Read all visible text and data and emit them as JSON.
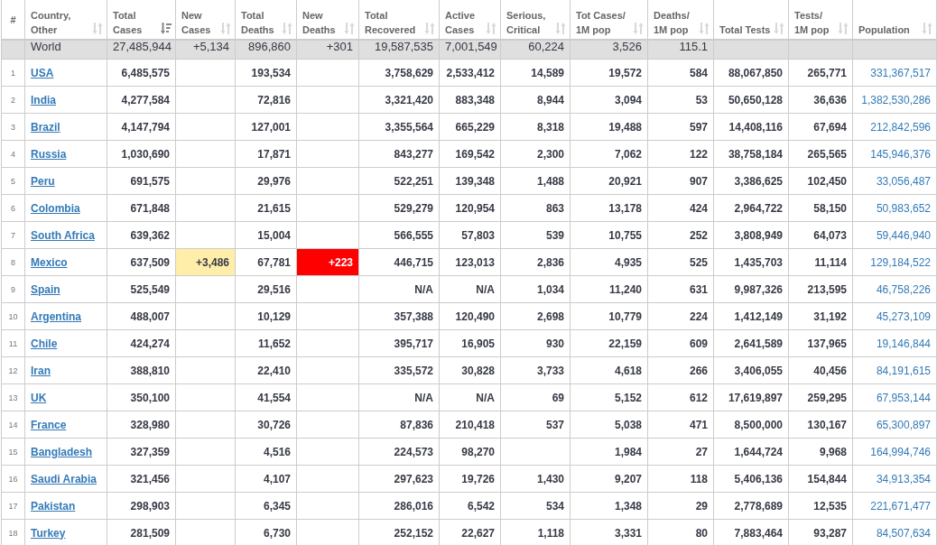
{
  "table": {
    "columns": [
      {
        "label": "#"
      },
      {
        "label": "Country, Other",
        "sorted": false
      },
      {
        "label": "Total Cases",
        "sorted": true
      },
      {
        "label": "New Cases",
        "sorted": false
      },
      {
        "label": "Total Deaths",
        "sorted": false
      },
      {
        "label": "New Deaths",
        "sorted": false
      },
      {
        "label": "Total Recovered",
        "sorted": false
      },
      {
        "label": "Active Cases",
        "sorted": false
      },
      {
        "label": "Serious, Critical",
        "sorted": false
      },
      {
        "label": "Tot Cases/ 1M pop",
        "sorted": false
      },
      {
        "label": "Deaths/ 1M pop",
        "sorted": false
      },
      {
        "label": "Total Tests",
        "sorted": false
      },
      {
        "label": "Tests/ 1M pop",
        "sorted": false
      },
      {
        "label": "Population",
        "sorted": false
      }
    ],
    "rows": [
      {
        "kind": "total",
        "country": "World",
        "total_cases": "27,485,944",
        "new_cases": "+5,134",
        "total_deaths": "896,860",
        "new_deaths": "+301",
        "total_recovered": "19,587,535",
        "active_cases": "7,001,549",
        "serious_critical": "60,224",
        "cases_per_1m": "3,526",
        "deaths_per_1m": "115.1"
      },
      {
        "kind": "country",
        "rank": "1",
        "country": "USA",
        "total_cases": "6,485,575",
        "total_deaths": "193,534",
        "total_recovered": "3,758,629",
        "active_cases": "2,533,412",
        "serious_critical": "14,589",
        "cases_per_1m": "19,572",
        "deaths_per_1m": "584",
        "total_tests": "88,067,850",
        "tests_per_1m": "265,771",
        "population": "331,367,517"
      },
      {
        "kind": "country",
        "rank": "2",
        "country": "India",
        "total_cases": "4,277,584",
        "total_deaths": "72,816",
        "total_recovered": "3,321,420",
        "active_cases": "883,348",
        "serious_critical": "8,944",
        "cases_per_1m": "3,094",
        "deaths_per_1m": "53",
        "total_tests": "50,650,128",
        "tests_per_1m": "36,636",
        "population": "1,382,530,286"
      },
      {
        "kind": "country",
        "rank": "3",
        "country": "Brazil",
        "total_cases": "4,147,794",
        "total_deaths": "127,001",
        "total_recovered": "3,355,564",
        "active_cases": "665,229",
        "serious_critical": "8,318",
        "cases_per_1m": "19,488",
        "deaths_per_1m": "597",
        "total_tests": "14,408,116",
        "tests_per_1m": "67,694",
        "population": "212,842,596"
      },
      {
        "kind": "country",
        "rank": "4",
        "country": "Russia",
        "total_cases": "1,030,690",
        "total_deaths": "17,871",
        "total_recovered": "843,277",
        "active_cases": "169,542",
        "serious_critical": "2,300",
        "cases_per_1m": "7,062",
        "deaths_per_1m": "122",
        "total_tests": "38,758,184",
        "tests_per_1m": "265,565",
        "population": "145,946,376"
      },
      {
        "kind": "country",
        "rank": "5",
        "country": "Peru",
        "total_cases": "691,575",
        "total_deaths": "29,976",
        "total_recovered": "522,251",
        "active_cases": "139,348",
        "serious_critical": "1,488",
        "cases_per_1m": "20,921",
        "deaths_per_1m": "907",
        "total_tests": "3,386,625",
        "tests_per_1m": "102,450",
        "population": "33,056,487"
      },
      {
        "kind": "country",
        "rank": "6",
        "country": "Colombia",
        "total_cases": "671,848",
        "total_deaths": "21,615",
        "total_recovered": "529,279",
        "active_cases": "120,954",
        "serious_critical": "863",
        "cases_per_1m": "13,178",
        "deaths_per_1m": "424",
        "total_tests": "2,964,722",
        "tests_per_1m": "58,150",
        "population": "50,983,652"
      },
      {
        "kind": "country",
        "rank": "7",
        "country": "South Africa",
        "total_cases": "639,362",
        "total_deaths": "15,004",
        "total_recovered": "566,555",
        "active_cases": "57,803",
        "serious_critical": "539",
        "cases_per_1m": "10,755",
        "deaths_per_1m": "252",
        "total_tests": "3,808,949",
        "tests_per_1m": "64,073",
        "population": "59,446,940"
      },
      {
        "kind": "country",
        "rank": "8",
        "country": "Mexico",
        "total_cases": "637,509",
        "new_cases": "+3,486",
        "total_deaths": "67,781",
        "new_deaths": "+223",
        "total_recovered": "446,715",
        "active_cases": "123,013",
        "serious_critical": "2,836",
        "cases_per_1m": "4,935",
        "deaths_per_1m": "525",
        "total_tests": "1,435,703",
        "tests_per_1m": "11,114",
        "population": "129,184,522"
      },
      {
        "kind": "country",
        "rank": "9",
        "country": "Spain",
        "total_cases": "525,549",
        "total_deaths": "29,516",
        "total_recovered": "N/A",
        "active_cases": "N/A",
        "serious_critical": "1,034",
        "cases_per_1m": "11,240",
        "deaths_per_1m": "631",
        "total_tests": "9,987,326",
        "tests_per_1m": "213,595",
        "population": "46,758,226"
      },
      {
        "kind": "country",
        "rank": "10",
        "country": "Argentina",
        "total_cases": "488,007",
        "total_deaths": "10,129",
        "total_recovered": "357,388",
        "active_cases": "120,490",
        "serious_critical": "2,698",
        "cases_per_1m": "10,779",
        "deaths_per_1m": "224",
        "total_tests": "1,412,149",
        "tests_per_1m": "31,192",
        "population": "45,273,109"
      },
      {
        "kind": "country",
        "rank": "11",
        "country": "Chile",
        "total_cases": "424,274",
        "total_deaths": "11,652",
        "total_recovered": "395,717",
        "active_cases": "16,905",
        "serious_critical": "930",
        "cases_per_1m": "22,159",
        "deaths_per_1m": "609",
        "total_tests": "2,641,589",
        "tests_per_1m": "137,965",
        "population": "19,146,844"
      },
      {
        "kind": "country",
        "rank": "12",
        "country": "Iran",
        "total_cases": "388,810",
        "total_deaths": "22,410",
        "total_recovered": "335,572",
        "active_cases": "30,828",
        "serious_critical": "3,733",
        "cases_per_1m": "4,618",
        "deaths_per_1m": "266",
        "total_tests": "3,406,055",
        "tests_per_1m": "40,456",
        "population": "84,191,615"
      },
      {
        "kind": "country",
        "rank": "13",
        "country": "UK",
        "total_cases": "350,100",
        "total_deaths": "41,554",
        "total_recovered": "N/A",
        "active_cases": "N/A",
        "serious_critical": "69",
        "cases_per_1m": "5,152",
        "deaths_per_1m": "612",
        "total_tests": "17,619,897",
        "tests_per_1m": "259,295",
        "population": "67,953,144"
      },
      {
        "kind": "country",
        "rank": "14",
        "country": "France",
        "total_cases": "328,980",
        "total_deaths": "30,726",
        "total_recovered": "87,836",
        "active_cases": "210,418",
        "serious_critical": "537",
        "cases_per_1m": "5,038",
        "deaths_per_1m": "471",
        "total_tests": "8,500,000",
        "tests_per_1m": "130,167",
        "population": "65,300,897"
      },
      {
        "kind": "country",
        "rank": "15",
        "country": "Bangladesh",
        "total_cases": "327,359",
        "total_deaths": "4,516",
        "total_recovered": "224,573",
        "active_cases": "98,270",
        "cases_per_1m": "1,984",
        "deaths_per_1m": "27",
        "total_tests": "1,644,724",
        "tests_per_1m": "9,968",
        "population": "164,994,746"
      },
      {
        "kind": "country",
        "rank": "16",
        "country": "Saudi Arabia",
        "total_cases": "321,456",
        "total_deaths": "4,107",
        "total_recovered": "297,623",
        "active_cases": "19,726",
        "serious_critical": "1,430",
        "cases_per_1m": "9,207",
        "deaths_per_1m": "118",
        "total_tests": "5,406,136",
        "tests_per_1m": "154,844",
        "population": "34,913,354"
      },
      {
        "kind": "country",
        "rank": "17",
        "country": "Pakistan",
        "total_cases": "298,903",
        "total_deaths": "6,345",
        "total_recovered": "286,016",
        "active_cases": "6,542",
        "serious_critical": "534",
        "cases_per_1m": "1,348",
        "deaths_per_1m": "29",
        "total_tests": "2,778,689",
        "tests_per_1m": "12,535",
        "population": "221,671,477"
      },
      {
        "kind": "country",
        "rank": "18",
        "country": "Turkey",
        "total_cases": "281,509",
        "total_deaths": "6,730",
        "total_recovered": "252,152",
        "active_cases": "22,627",
        "serious_critical": "1,118",
        "cases_per_1m": "3,331",
        "deaths_per_1m": "80",
        "total_tests": "7,883,464",
        "tests_per_1m": "93,287",
        "population": "84,507,634"
      }
    ]
  }
}
